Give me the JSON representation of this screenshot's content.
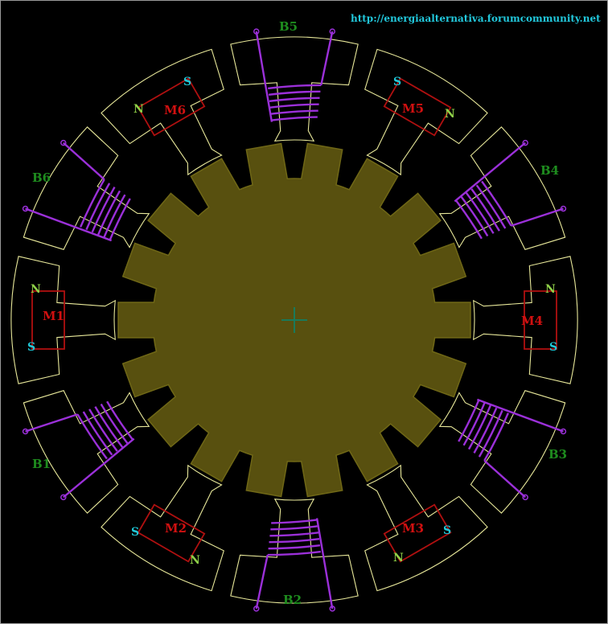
{
  "source_url": "http://energiaalternativa.forumcommunity.net",
  "colors": {
    "background": "#000000",
    "frame": "#9a9a9a",
    "stator_outline": "#e8e89a",
    "rotor_fill": "#58500f",
    "rotor_edge": "#6f6716",
    "coil_wire": "#9b30d9",
    "magnet_box": "#b01010",
    "magnet_text": "#d01010",
    "coil_label": "#1e8c1e",
    "pole_n": "#8fd048",
    "pole_s": "#20c8d8",
    "url_text": "#22c8dc",
    "center_mark": "#1a7a5a"
  },
  "coils": [
    {
      "label": "B1"
    },
    {
      "label": "B2"
    },
    {
      "label": "B3"
    },
    {
      "label": "B4"
    },
    {
      "label": "B5"
    },
    {
      "label": "B6"
    }
  ],
  "magnets": [
    {
      "label": "M1",
      "pole_top": "N",
      "pole_bottom": "S"
    },
    {
      "label": "M2",
      "pole_left": "S",
      "pole_right": "N"
    },
    {
      "label": "M3",
      "pole_left": "N",
      "pole_right": "S"
    },
    {
      "label": "M4",
      "pole_top": "N",
      "pole_bottom": "S"
    },
    {
      "label": "M5",
      "pole_left": "S",
      "pole_right": "N"
    },
    {
      "label": "M6",
      "pole_left": "N",
      "pole_right": "S"
    }
  ]
}
